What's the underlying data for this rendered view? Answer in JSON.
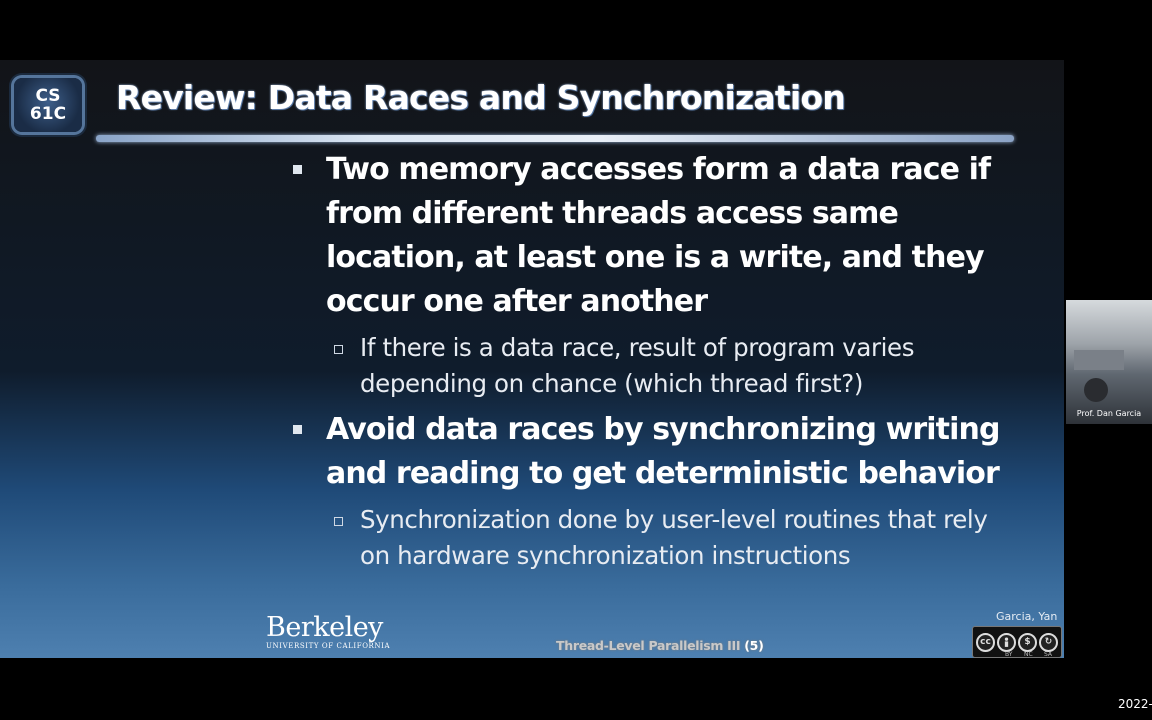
{
  "slide": {
    "logo": {
      "line1": "CS",
      "line2": "61C"
    },
    "title": "Review: Data Races and Synchronization",
    "bullets": [
      {
        "text": "Two memory accesses form a data race if from different threads access same location, at least one is a write, and they occur one after another",
        "sub": "If there is a data race, result of program varies depending on chance (which thread first?)"
      },
      {
        "text": "Avoid data races by synchronizing writing and reading to get deterministic behavior",
        "sub": "Synchronization done by user-level routines that rely on hardware synchronization instructions"
      }
    ],
    "footer": {
      "institution": "Berkeley",
      "institution_sub": "UNIVERSITY OF CALIFORNIA",
      "course_title": "Thread-Level Parallelism III",
      "page": "(5)",
      "authors": "Garcia, Yan",
      "license": {
        "badges": [
          "cc",
          "by",
          "nc",
          "sa"
        ],
        "labels": [
          "BY",
          "NC",
          "SA"
        ]
      }
    }
  },
  "video": {
    "label": "Prof. Dan Garcia"
  },
  "overlay": {
    "timestamp": "2022-"
  },
  "colors": {
    "background": "#000000",
    "slide_top": "#121418",
    "slide_bottom": "#4e80b0",
    "text": "#ffffff"
  }
}
